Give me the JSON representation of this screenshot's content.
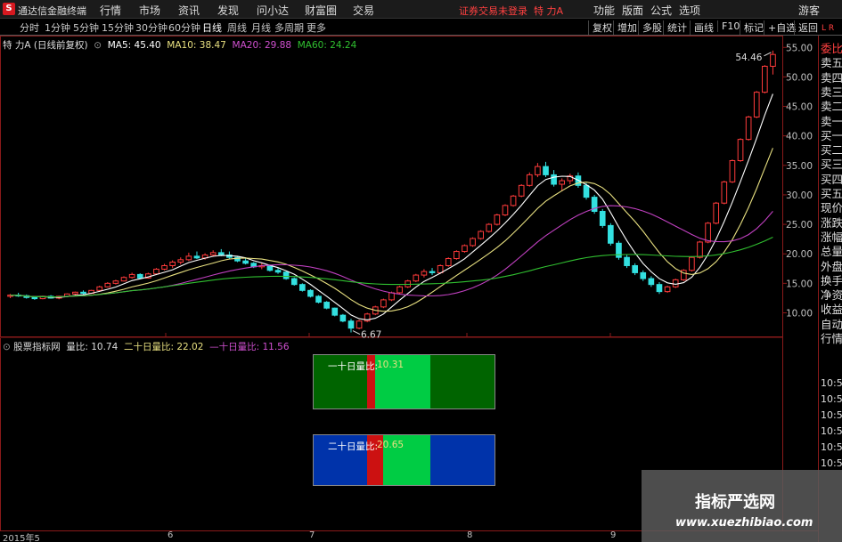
{
  "app": {
    "logo_char": "S",
    "title": "通达信金融终端"
  },
  "menu": [
    "行情",
    "市场",
    "资讯",
    "发现",
    "问小达",
    "财富圈",
    "交易"
  ],
  "login_status": "证券交易未登录",
  "stock_name": "特 力A",
  "right_menu": [
    "功能",
    "版面",
    "公式",
    "选项",
    "游客"
  ],
  "periods": [
    "分时",
    "1分钟",
    "5分钟",
    "15分钟",
    "30分钟",
    "60分钟",
    "日线",
    "周线",
    "月线",
    "多周期",
    "更多"
  ],
  "active_period": "日线",
  "tools": [
    "复权",
    "增加",
    "多股",
    "统计",
    "画线",
    "F10",
    "标记",
    "+自选",
    "返回"
  ],
  "main_info": {
    "title": "特 力A (日线前复权)",
    "ma5": "MA5: 45.40",
    "ma10": "MA10: 38.47",
    "ma20": "MA20: 29.88",
    "ma60": "MA60: 24.24"
  },
  "sub_info": {
    "title": "股票指标网",
    "v1": "量比: 10.74",
    "v2": "二十日量比: 22.02",
    "v3": "—十日量比: 11.56"
  },
  "box1": {
    "label": "一十日量比:",
    "value": "10.31"
  },
  "box2": {
    "label": "二十日量比:",
    "value": "20.65"
  },
  "price_axis": [
    "55.00",
    "50.00",
    "45.00",
    "40.00",
    "35.00",
    "30.00",
    "25.00",
    "20.00",
    "15.00",
    "10.00"
  ],
  "high_label": "54.46",
  "low_label": "6.67",
  "right_panel_items": [
    "委比",
    "卖五",
    "卖四",
    "卖三",
    "卖二",
    "卖一",
    "买一",
    "买二",
    "买三",
    "买四",
    "买五",
    "现价",
    "涨跌",
    "涨幅",
    "总量",
    "外盘",
    "换手",
    "净资",
    "收益",
    "自动",
    "行情"
  ],
  "right_panel_times": [
    "10:50",
    "10:50",
    "10:50",
    "10:50",
    "10:50",
    "10:5"
  ],
  "right_panel_top": "L R",
  "date_axis": [
    "2015年5",
    "6",
    "7",
    "8",
    "9"
  ],
  "watermark": {
    "cn": "指标严选网",
    "url": "www.xuezhibiao.com"
  },
  "colors": {
    "up": "#ff3b3b",
    "down": "#33e0e0",
    "ma5": "#ffffff",
    "ma10": "#e8e080",
    "ma20": "#c040c0",
    "ma60": "#30c030",
    "grid": "#8b1a1a",
    "box1_dark": "#006400",
    "box1_light": "#00cc44",
    "box2_blue": "#0033aa",
    "bar_red": "#cc1111"
  },
  "chart_data": {
    "type": "candlestick",
    "ylim": [
      6,
      57
    ],
    "candles": [
      [
        12.8,
        13.2,
        12.5,
        13.0
      ],
      [
        13.0,
        13.4,
        12.7,
        12.9
      ],
      [
        12.9,
        13.1,
        12.4,
        12.6
      ],
      [
        12.6,
        12.8,
        12.2,
        12.4
      ],
      [
        12.4,
        12.9,
        12.3,
        12.8
      ],
      [
        12.8,
        13.0,
        12.4,
        12.5
      ],
      [
        12.5,
        12.9,
        12.3,
        12.8
      ],
      [
        12.8,
        13.3,
        12.7,
        13.2
      ],
      [
        13.2,
        13.6,
        13.0,
        13.5
      ],
      [
        13.5,
        13.8,
        13.1,
        13.3
      ],
      [
        13.3,
        13.9,
        13.2,
        13.8
      ],
      [
        13.8,
        14.6,
        13.7,
        14.4
      ],
      [
        14.4,
        15.2,
        14.3,
        15.0
      ],
      [
        15.0,
        15.6,
        14.8,
        15.4
      ],
      [
        15.4,
        16.2,
        15.3,
        16.0
      ],
      [
        16.0,
        16.8,
        15.8,
        16.5
      ],
      [
        16.5,
        16.7,
        15.7,
        15.9
      ],
      [
        15.9,
        16.8,
        15.8,
        16.6
      ],
      [
        16.6,
        17.6,
        16.4,
        17.4
      ],
      [
        17.4,
        18.3,
        17.2,
        18.0
      ],
      [
        18.0,
        18.9,
        17.6,
        18.6
      ],
      [
        18.6,
        19.4,
        18.2,
        19.0
      ],
      [
        19.0,
        20.2,
        18.8,
        19.6
      ],
      [
        19.6,
        20.4,
        19.1,
        19.3
      ],
      [
        19.3,
        20.1,
        19.0,
        19.8
      ],
      [
        19.8,
        20.6,
        19.6,
        20.2
      ],
      [
        20.2,
        20.8,
        19.6,
        19.8
      ],
      [
        19.8,
        20.4,
        19.2,
        19.4
      ],
      [
        19.4,
        19.6,
        18.6,
        18.8
      ],
      [
        18.8,
        19.2,
        18.2,
        18.4
      ],
      [
        18.4,
        18.6,
        17.6,
        17.8
      ],
      [
        17.8,
        18.4,
        17.4,
        18.0
      ],
      [
        18.0,
        18.2,
        17.0,
        17.2
      ],
      [
        17.2,
        17.6,
        16.6,
        16.9
      ],
      [
        16.9,
        17.0,
        15.6,
        15.8
      ],
      [
        15.8,
        16.0,
        14.6,
        14.8
      ],
      [
        14.8,
        15.0,
        13.6,
        13.8
      ],
      [
        13.8,
        14.0,
        12.6,
        12.8
      ],
      [
        12.8,
        13.0,
        11.6,
        11.8
      ],
      [
        11.8,
        12.0,
        10.6,
        10.8
      ],
      [
        10.8,
        10.9,
        9.4,
        9.6
      ],
      [
        9.6,
        9.8,
        8.4,
        8.6
      ],
      [
        8.6,
        9.0,
        6.67,
        7.4
      ],
      [
        7.4,
        8.8,
        7.2,
        8.6
      ],
      [
        8.6,
        10.0,
        8.4,
        9.8
      ],
      [
        9.8,
        11.2,
        9.6,
        11.0
      ],
      [
        11.0,
        12.4,
        10.8,
        12.2
      ],
      [
        12.2,
        13.6,
        12.0,
        13.4
      ],
      [
        13.4,
        14.6,
        13.2,
        14.4
      ],
      [
        14.4,
        15.6,
        14.2,
        15.4
      ],
      [
        15.4,
        16.6,
        15.2,
        16.4
      ],
      [
        16.4,
        17.4,
        16.0,
        17.0
      ],
      [
        17.0,
        17.6,
        16.4,
        16.8
      ],
      [
        16.8,
        18.2,
        16.6,
        18.0
      ],
      [
        18.0,
        19.4,
        17.8,
        19.2
      ],
      [
        19.2,
        20.6,
        19.0,
        20.4
      ],
      [
        20.4,
        21.6,
        20.2,
        21.4
      ],
      [
        21.4,
        22.8,
        21.2,
        22.6
      ],
      [
        22.6,
        24.0,
        22.4,
        23.8
      ],
      [
        23.8,
        25.2,
        23.6,
        25.0
      ],
      [
        25.0,
        26.8,
        24.8,
        26.6
      ],
      [
        26.6,
        28.4,
        26.4,
        28.2
      ],
      [
        28.2,
        30.0,
        28.0,
        29.8
      ],
      [
        29.8,
        31.8,
        29.6,
        31.6
      ],
      [
        31.6,
        33.8,
        31.4,
        33.4
      ],
      [
        33.4,
        35.4,
        33.0,
        34.8
      ],
      [
        34.8,
        35.6,
        33.0,
        33.4
      ],
      [
        33.4,
        34.2,
        31.4,
        31.8
      ],
      [
        31.8,
        32.8,
        30.6,
        32.4
      ],
      [
        32.4,
        33.6,
        31.8,
        33.2
      ],
      [
        33.2,
        33.8,
        31.2,
        31.6
      ],
      [
        31.6,
        32.0,
        29.2,
        29.6
      ],
      [
        29.6,
        30.0,
        26.8,
        27.2
      ],
      [
        27.2,
        27.6,
        24.4,
        24.8
      ],
      [
        24.8,
        25.2,
        21.4,
        21.8
      ],
      [
        21.8,
        22.2,
        19.0,
        19.4
      ],
      [
        19.4,
        19.8,
        17.6,
        18.0
      ],
      [
        18.0,
        18.4,
        16.4,
        16.8
      ],
      [
        16.8,
        17.2,
        15.4,
        15.8
      ],
      [
        15.8,
        16.2,
        14.4,
        14.8
      ],
      [
        14.8,
        15.2,
        13.2,
        13.6
      ],
      [
        13.6,
        14.6,
        13.4,
        14.4
      ],
      [
        14.4,
        15.8,
        14.2,
        15.6
      ],
      [
        15.6,
        17.4,
        15.4,
        17.2
      ],
      [
        17.2,
        19.6,
        17.0,
        19.4
      ],
      [
        19.4,
        22.2,
        19.2,
        22.0
      ],
      [
        22.0,
        25.4,
        21.8,
        25.2
      ],
      [
        25.2,
        28.8,
        25.0,
        28.6
      ],
      [
        28.6,
        32.4,
        28.4,
        32.2
      ],
      [
        32.2,
        36.0,
        32.0,
        35.8
      ],
      [
        35.8,
        39.6,
        35.6,
        39.4
      ],
      [
        39.4,
        43.4,
        39.2,
        43.2
      ],
      [
        43.2,
        47.6,
        43.0,
        47.4
      ],
      [
        47.4,
        52.0,
        47.2,
        51.8
      ],
      [
        51.8,
        54.46,
        50.4,
        53.8
      ]
    ]
  }
}
